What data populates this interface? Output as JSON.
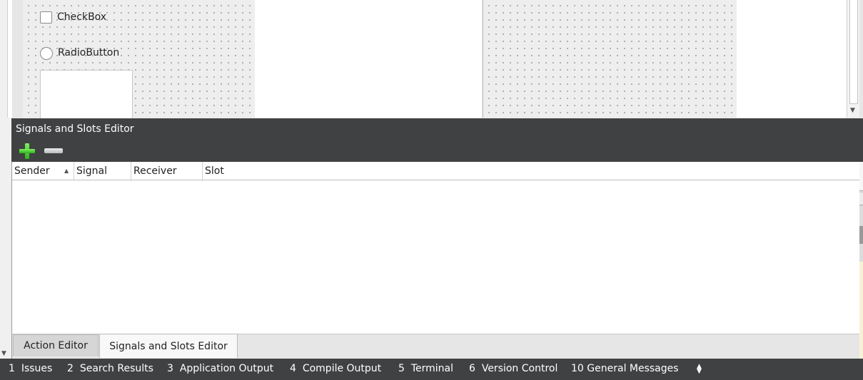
{
  "designer": {
    "checkbox_label": "CheckBox",
    "radio_label": "RadioButton"
  },
  "editor": {
    "title": "Signals and Slots Editor",
    "add_icon": "plus-icon",
    "remove_icon": "minus-icon",
    "columns": [
      "Sender",
      "Signal",
      "Receiver",
      "Slot"
    ],
    "sort_indicator": "▲"
  },
  "tabs": {
    "action_editor": "Action Editor",
    "signals_slots_editor": "Signals and Slots Editor"
  },
  "statusbar": {
    "items": [
      {
        "num": "1",
        "label": "Issues"
      },
      {
        "num": "2",
        "label": "Search Results"
      },
      {
        "num": "3",
        "label": "Application Output"
      },
      {
        "num": "4",
        "label": "Compile Output"
      },
      {
        "num": "5",
        "label": "Terminal"
      },
      {
        "num": "6",
        "label": "Version Control"
      },
      {
        "num": "10",
        "label": "General Messages"
      }
    ]
  },
  "colors": {
    "dark_panel": "#404142",
    "plus_green": "#3ccf28"
  }
}
